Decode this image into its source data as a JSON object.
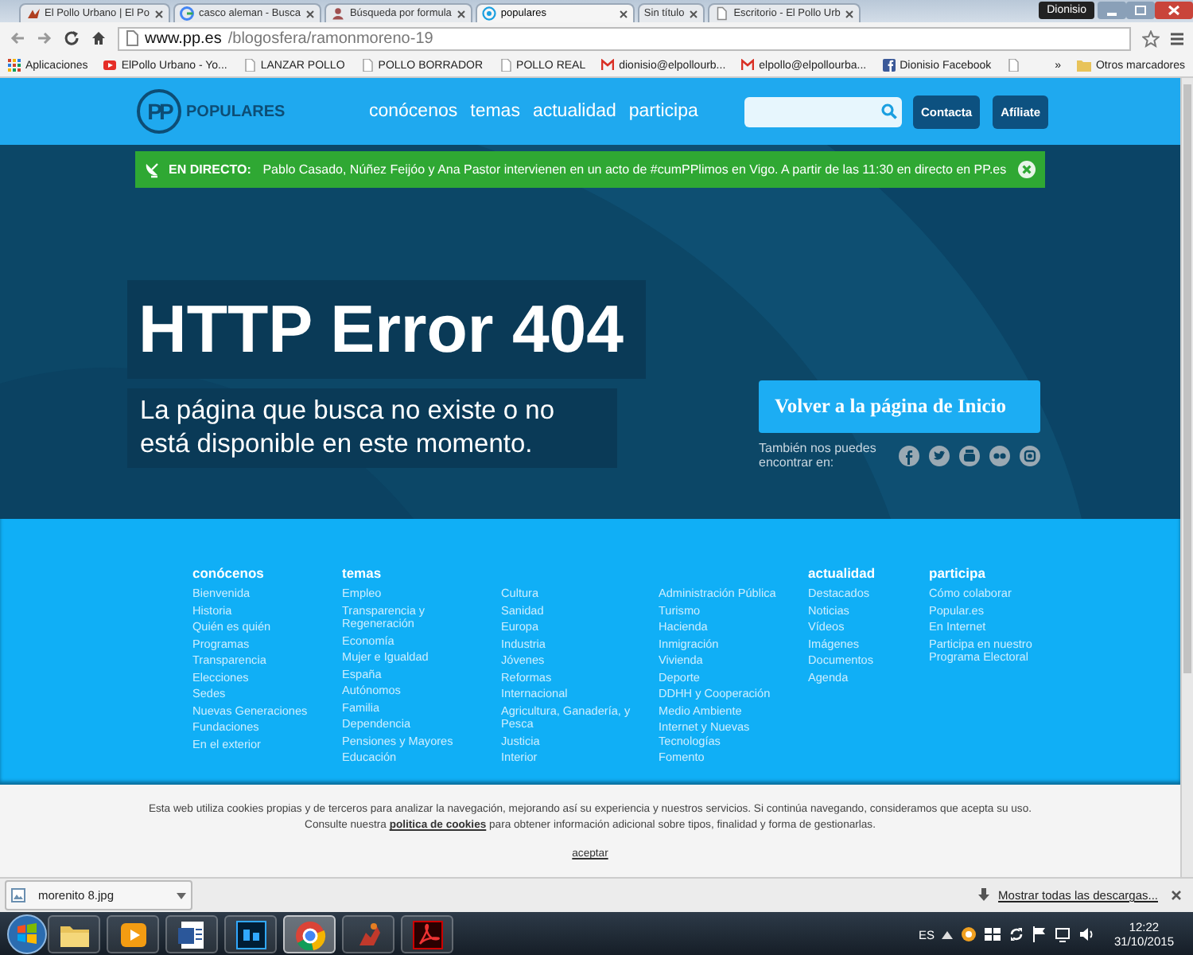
{
  "browser": {
    "tabs": [
      {
        "title": "El Pollo Urbano | El Po",
        "selected": false
      },
      {
        "title": "casco aleman - Busca",
        "selected": false
      },
      {
        "title": "Búsqueda por formula",
        "selected": false
      },
      {
        "title": "populares",
        "selected": true
      },
      {
        "title": "Sin título",
        "selected": false
      },
      {
        "title": "Escritorio - El Pollo Urb",
        "selected": false
      }
    ],
    "user": "Dionisio",
    "url_host": "www.pp.es",
    "url_path": "/blogosfera/ramonmoreno-19",
    "bookmarks": [
      {
        "label": "Aplicaciones",
        "kind": "apps"
      },
      {
        "label": "ElPollo Urbano - Yo...",
        "kind": "video"
      },
      {
        "label": "LANZAR POLLO",
        "kind": "page"
      },
      {
        "label": "POLLO BORRADOR",
        "kind": "page"
      },
      {
        "label": "POLLO REAL",
        "kind": "page"
      },
      {
        "label": "dionisio@elpollourb...",
        "kind": "mail"
      },
      {
        "label": "elpollo@elpollourba...",
        "kind": "mail"
      },
      {
        "label": "Dionisio Facebook",
        "kind": "facebook"
      },
      {
        "kind": "page"
      }
    ],
    "more": "»",
    "other_bookmarks": "Otros marcadores"
  },
  "site": {
    "logo_mark": "PP",
    "logo_text": "POPULARES",
    "nav": [
      "conócenos",
      "temas",
      "actualidad",
      "participa"
    ],
    "buttons": [
      "Contacta",
      "Afíliate"
    ]
  },
  "live": {
    "label": "EN DIRECTO:",
    "text": "Pablo Casado, Núñez Feijóo y Ana Pastor intervienen en un acto de #cumPPlimos en Vigo. A partir de las 11:30 en directo en PP.es"
  },
  "error": {
    "title": "HTTP Error 404",
    "message": "La página que busca no existe o no está disponible en este momento.",
    "home_button": "Volver a la página de Inicio",
    "social_label": "También nos puedes encontrar en:"
  },
  "footer": {
    "columns": [
      {
        "heading": "conócenos",
        "links": [
          "Bienvenida",
          "Historia",
          "Quién es quién",
          "Programas",
          "Transparencia",
          "Elecciones",
          "Sedes",
          "Nuevas Generaciones",
          "Fundaciones",
          "En el exterior"
        ]
      },
      {
        "heading": "temas",
        "links": [
          "Empleo",
          "Transparencia y Regeneración",
          "Economía",
          "Mujer e Igualdad",
          "España",
          "Autónomos",
          "Familia",
          "Dependencia",
          "Pensiones y Mayores",
          "Educación"
        ]
      },
      {
        "links": [
          "Cultura",
          "Sanidad",
          "Europa",
          "Industria",
          "Jóvenes",
          "Reformas",
          "Internacional",
          "Agricultura, Ganadería, y Pesca",
          "Justicia",
          "Interior"
        ]
      },
      {
        "links": [
          "Administración Pública",
          "Turismo",
          "Hacienda",
          "Inmigración",
          "Vivienda",
          "Deporte",
          "DDHH y Cooperación",
          "Medio Ambiente",
          "Internet y Nuevas Tecnologías",
          "Fomento"
        ]
      },
      {
        "heading": "actualidad",
        "links": [
          "Destacados",
          "Noticias",
          "Vídeos",
          "Imágenes",
          "Documentos",
          "Agenda"
        ]
      },
      {
        "heading": "participa",
        "links": [
          "Cómo colaborar",
          "Popular.es",
          "En Internet",
          "Participa en nuestro Programa Electoral"
        ]
      }
    ]
  },
  "cookies": {
    "text_before": "Esta web utiliza cookies propias y de terceros para analizar la navegación, mejorando así su experiencia y nuestros servicios. Si continúa navegando, consideramos que acepta su uso. Consulte nuestra",
    "link": "politica de cookies",
    "text_after": "para obtener información adicional sobre tipos, finalidad y forma de gestionarlas.",
    "accept": "aceptar"
  },
  "downloads": {
    "file": "morenito 8.jpg",
    "show_all": "Mostrar todas las descargas..."
  },
  "taskbar": {
    "apps": [
      {
        "kind": "folder",
        "selected": false
      },
      {
        "kind": "media",
        "selected": false
      },
      {
        "kind": "word",
        "selected": false
      },
      {
        "kind": "photoshop",
        "selected": false
      },
      {
        "kind": "chrome",
        "selected": true
      },
      {
        "kind": "game",
        "selected": false
      },
      {
        "kind": "pdf",
        "selected": false
      }
    ],
    "lang": "ES",
    "time": "12:22",
    "date": "31/10/2015"
  }
}
